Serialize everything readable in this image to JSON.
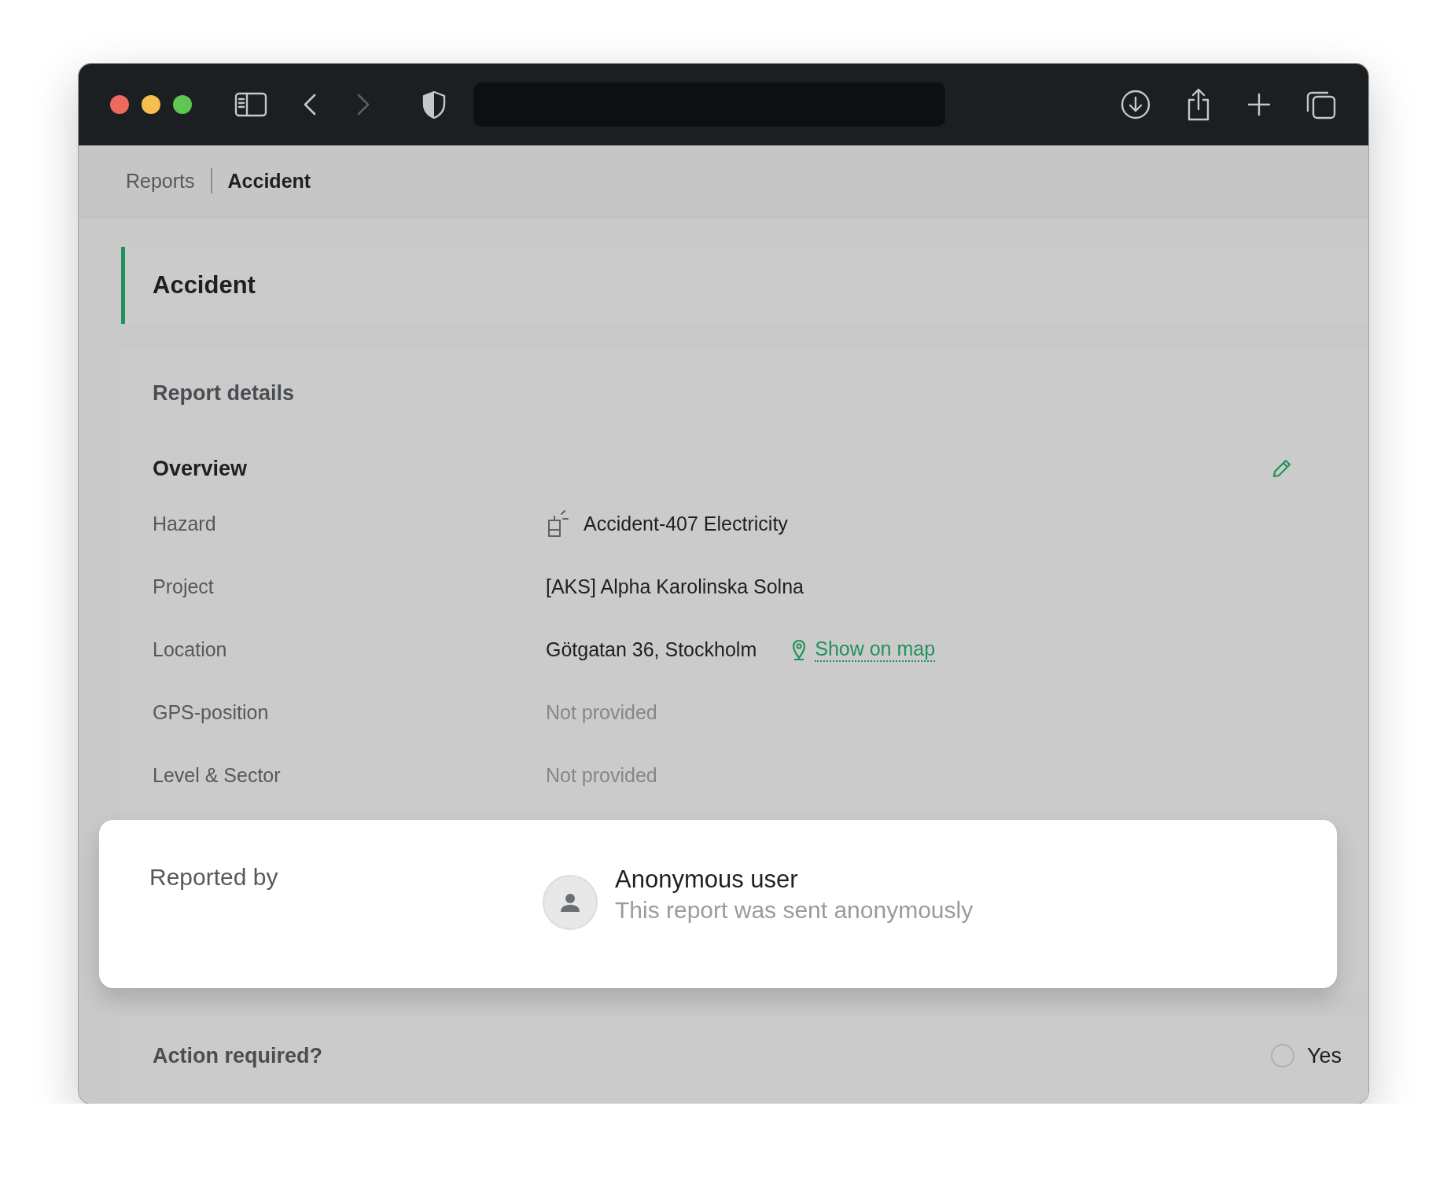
{
  "browser": {
    "traffic_lights": [
      {
        "color": "#ed6a5e"
      },
      {
        "color": "#f5bf4f"
      },
      {
        "color": "#61c554"
      }
    ],
    "back": {
      "disabled": false
    },
    "forward": {
      "disabled": true
    }
  },
  "breadcrumb": [
    {
      "label": "Reports",
      "selected": false
    },
    {
      "label": "Accident",
      "selected": true
    }
  ],
  "page_title": "Accident",
  "report_details": {
    "title": "Report details",
    "section": "Overview",
    "rows": [
      {
        "kind": "hazard",
        "label": "Hazard",
        "value": "Accident-407 Electricity"
      },
      {
        "kind": "text",
        "label": "Project",
        "value": "[AKS] Alpha Karolinska Solna"
      },
      {
        "kind": "location",
        "label": "Location",
        "value": "Götgatan 36, Stockholm",
        "link": "Show on map"
      },
      {
        "kind": "missing",
        "label": "GPS-position",
        "value": "Not provided"
      },
      {
        "kind": "missing",
        "label": "Level & Sector",
        "value": "Not provided"
      }
    ],
    "reported_by": {
      "label": "Reported by",
      "name": "Anonymous user",
      "note": "This report was sent anonymously"
    }
  },
  "action": {
    "question": "Action required?",
    "option": {
      "label": "Yes",
      "selected": false
    }
  }
}
